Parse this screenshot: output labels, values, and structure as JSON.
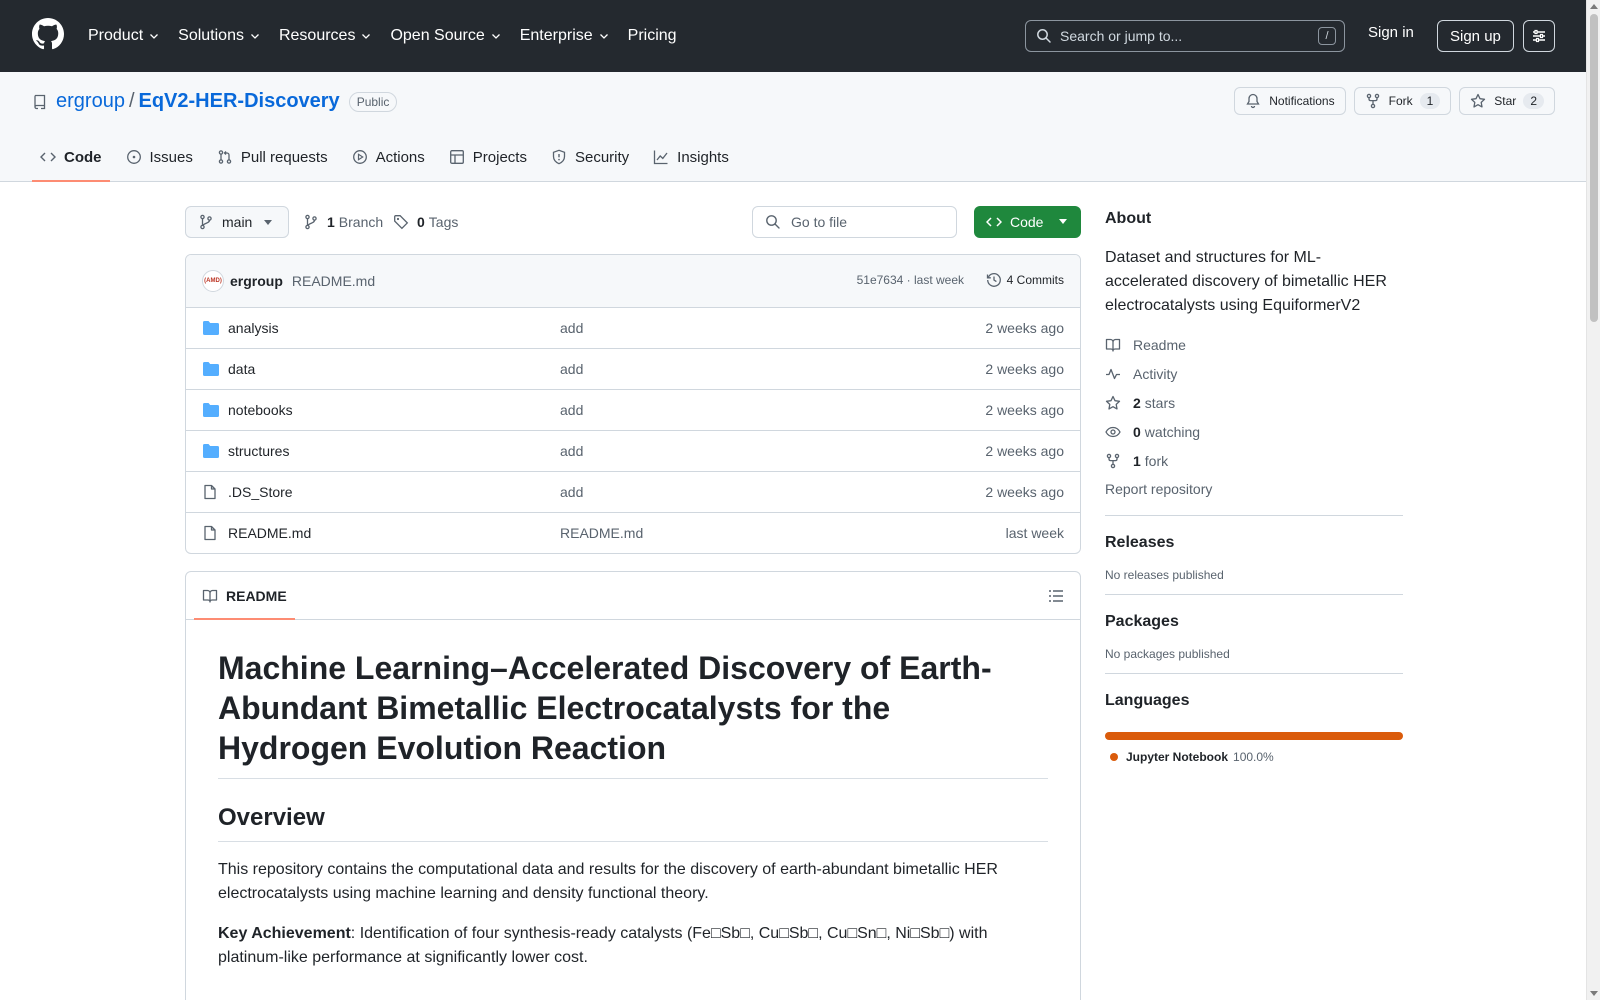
{
  "header": {
    "nav": [
      {
        "label": "Product",
        "has_menu": true
      },
      {
        "label": "Solutions",
        "has_menu": true
      },
      {
        "label": "Resources",
        "has_menu": true
      },
      {
        "label": "Open Source",
        "has_menu": true
      },
      {
        "label": "Enterprise",
        "has_menu": true
      },
      {
        "label": "Pricing",
        "has_menu": false
      }
    ],
    "search_placeholder": "Search or jump to...",
    "search_shortcut": "/",
    "signin": "Sign in",
    "signup": "Sign up"
  },
  "repo": {
    "owner": "ergroup",
    "separator": "/",
    "name": "EqV2-HER-Discovery",
    "visibility": "Public",
    "notifications_label": "Notifications",
    "fork_label": "Fork",
    "fork_count": "1",
    "star_label": "Star",
    "star_count": "2"
  },
  "tabs": [
    {
      "label": "Code",
      "icon": "code-icon",
      "active": true
    },
    {
      "label": "Issues",
      "icon": "issue-icon"
    },
    {
      "label": "Pull requests",
      "icon": "pull-request-icon"
    },
    {
      "label": "Actions",
      "icon": "play-icon"
    },
    {
      "label": "Projects",
      "icon": "table-icon"
    },
    {
      "label": "Security",
      "icon": "shield-icon"
    },
    {
      "label": "Insights",
      "icon": "graph-icon"
    }
  ],
  "toolbar": {
    "branch": "main",
    "branch_count": "1",
    "branch_label": "Branch",
    "tag_count": "0",
    "tag_label": "Tags",
    "goto_placeholder": "Go to file",
    "code_button": "Code"
  },
  "commit": {
    "avatar_text": "(AMD)",
    "author": "ergroup",
    "message": "README.md",
    "sha_time": "51e7634 · last week",
    "commits_label": "4 Commits"
  },
  "files": [
    {
      "type": "folder",
      "name": "analysis",
      "message": "add",
      "date": "2 weeks ago"
    },
    {
      "type": "folder",
      "name": "data",
      "message": "add",
      "date": "2 weeks ago"
    },
    {
      "type": "folder",
      "name": "notebooks",
      "message": "add",
      "date": "2 weeks ago"
    },
    {
      "type": "folder",
      "name": "structures",
      "message": "add",
      "date": "2 weeks ago"
    },
    {
      "type": "file",
      "name": ".DS_Store",
      "message": "add",
      "date": "2 weeks ago"
    },
    {
      "type": "file",
      "name": "README.md",
      "message": "README.md",
      "date": "last week"
    }
  ],
  "readme": {
    "tab_label": "README",
    "title": "Machine Learning–Accelerated Discovery of Earth-Abundant Bimetallic Electrocatalysts for the Hydrogen Evolution Reaction",
    "overview_heading": "Overview",
    "overview_text": "This repository contains the computational data and results for the discovery of earth-abundant bimetallic HER electrocatalysts using machine learning and density functional theory.",
    "key_label": "Key Achievement",
    "key_text": ": Identification of four synthesis-ready catalysts (Fe□Sb□, Cu□Sb□, Cu□Sn□, Ni□Sb□) with platinum-like performance at significantly lower cost."
  },
  "sidebar": {
    "about_heading": "About",
    "description": "Dataset and structures for ML-accelerated discovery of bimetallic HER electrocatalysts using EquiformerV2",
    "readme_link": "Readme",
    "activity_link": "Activity",
    "stars_count": "2",
    "stars_label": "stars",
    "watching_count": "0",
    "watching_label": "watching",
    "fork_count": "1",
    "fork_label": "fork",
    "report": "Report repository",
    "releases_heading": "Releases",
    "releases_text": "No releases published",
    "packages_heading": "Packages",
    "packages_text": "No packages published",
    "languages_heading": "Languages",
    "language_name": "Jupyter Notebook",
    "language_pct": "100.0%",
    "language_color": "#da5b0b"
  }
}
